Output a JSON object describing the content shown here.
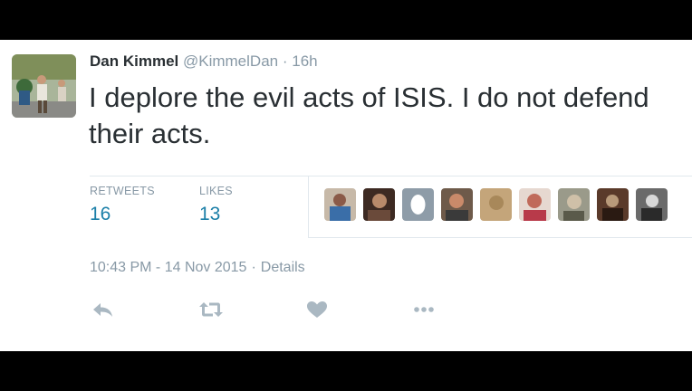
{
  "tweet": {
    "author_name": "Dan Kimmel",
    "handle": "@KimmelDan",
    "separator": "·",
    "age": "16h",
    "text": "I deplore the evil acts of ISIS. I do not defend their acts.",
    "stats": {
      "retweets_label": "RETWEETS",
      "retweets_count": "16",
      "likes_label": "LIKES",
      "likes_count": "13"
    },
    "liker_avatars": [
      "liker-avatar-1",
      "liker-avatar-2",
      "liker-avatar-3",
      "liker-avatar-4",
      "liker-avatar-5",
      "liker-avatar-6",
      "liker-avatar-7",
      "liker-avatar-8",
      "liker-avatar-9",
      "liker-avatar-10"
    ],
    "timestamp": "10:43 PM - 14 Nov 2015",
    "details_link": "Details",
    "actions": [
      "reply-icon",
      "retweet-icon",
      "like-icon",
      "more-icon"
    ]
  },
  "colors": {
    "background_frame": "#000000",
    "card_background": "#ffffff",
    "name_text": "#292f33",
    "muted_text": "#8899a6",
    "stat_value": "#1b7fa8",
    "action_icon": "#aab8c2",
    "divider": "#e1e8ed"
  }
}
